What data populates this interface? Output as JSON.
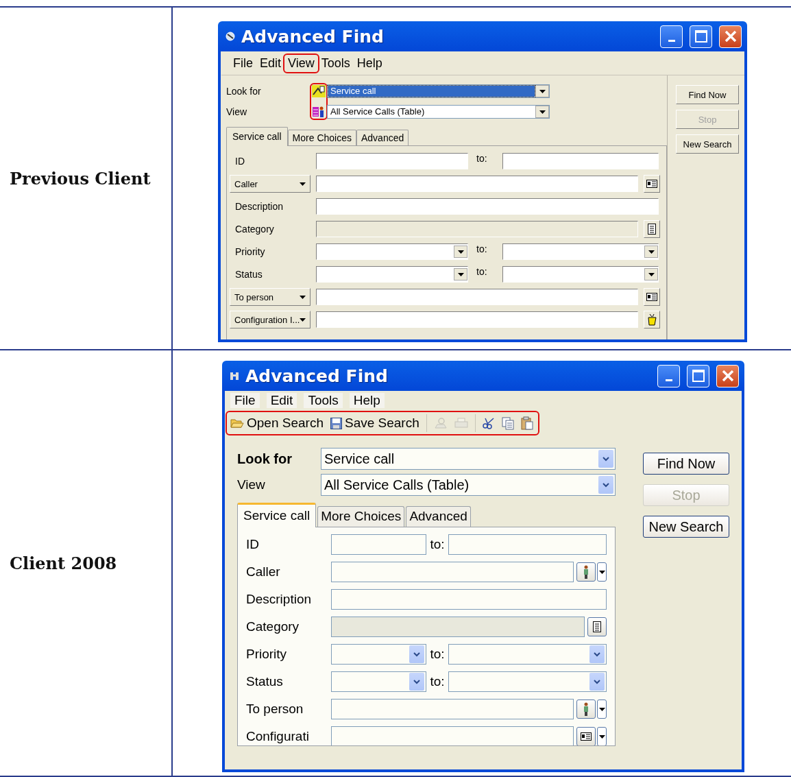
{
  "comparison": [
    {
      "label": "Previous Client",
      "window": {
        "kind": "classic",
        "title": "Advanced Find",
        "menu": [
          {
            "label": "File",
            "highlighted": false
          },
          {
            "label": "Edit",
            "highlighted": false
          },
          {
            "label": "View",
            "highlighted": true
          },
          {
            "label": "Tools",
            "highlighted": false
          },
          {
            "label": "Help",
            "highlighted": false
          }
        ],
        "type_icons_highlighted": true,
        "selectors": [
          {
            "label": "Look for",
            "value": "Service call",
            "selected": true
          },
          {
            "label": "View",
            "value": "All Service Calls (Table)",
            "selected": false
          }
        ],
        "tabs": [
          {
            "label": "Service call",
            "selected": true
          },
          {
            "label": "More Choices",
            "selected": false
          },
          {
            "label": "Advanced",
            "selected": false
          }
        ],
        "fields": [
          {
            "kind": "range",
            "label": "ID",
            "to": "to:",
            "label_dropdown": false
          },
          {
            "kind": "lookup",
            "label": "Caller",
            "label_dropdown": true
          },
          {
            "kind": "text",
            "label": "Description",
            "label_dropdown": false
          },
          {
            "kind": "category",
            "label": "Category",
            "label_dropdown": false
          },
          {
            "kind": "select_range",
            "label": "Priority",
            "to": "to:",
            "label_dropdown": false
          },
          {
            "kind": "select_range",
            "label": "Status",
            "to": "to:",
            "label_dropdown": false
          },
          {
            "kind": "lookup",
            "label": "To person",
            "label_dropdown": true
          },
          {
            "kind": "item",
            "label": "Configuration I...",
            "label_dropdown": true
          }
        ],
        "buttons": [
          {
            "label": "Find Now",
            "disabled": false
          },
          {
            "label": "Stop",
            "disabled": true
          },
          {
            "label": "New Search",
            "disabled": false
          }
        ]
      }
    },
    {
      "label": "Client 2008",
      "window": {
        "kind": "modern",
        "title": "Advanced Find",
        "menu": [
          {
            "label": "File",
            "highlighted": false
          },
          {
            "label": "Edit",
            "highlighted": false
          },
          {
            "label": "Tools",
            "highlighted": false
          },
          {
            "label": "Help",
            "highlighted": false
          }
        ],
        "toolbar_highlighted": true,
        "toolbar": [
          {
            "kind": "open",
            "label": "Open Search",
            "disabled": false
          },
          {
            "kind": "save",
            "label": "Save Search",
            "disabled": false
          },
          {
            "kind": "separator"
          },
          {
            "kind": "preview",
            "disabled": true
          },
          {
            "kind": "print",
            "disabled": true
          },
          {
            "kind": "separator"
          },
          {
            "kind": "cut",
            "disabled": false
          },
          {
            "kind": "copy",
            "disabled": false
          },
          {
            "kind": "paste",
            "disabled": false
          }
        ],
        "selectors": [
          {
            "label": "Look for",
            "value": "Service call",
            "bold": true
          },
          {
            "label": "View",
            "value": "All Service Calls (Table)",
            "bold": false
          }
        ],
        "tabs": [
          {
            "label": "Service call",
            "selected": true
          },
          {
            "label": "More Choices",
            "selected": false
          },
          {
            "label": "Advanced",
            "selected": false
          }
        ],
        "fields": [
          {
            "kind": "range",
            "label": "ID",
            "to": "to:"
          },
          {
            "kind": "lookup",
            "label": "Caller"
          },
          {
            "kind": "text",
            "label": "Description"
          },
          {
            "kind": "category",
            "label": "Category"
          },
          {
            "kind": "select_range",
            "label": "Priority",
            "to": "to:"
          },
          {
            "kind": "select_range",
            "label": "Status",
            "to": "to:"
          },
          {
            "kind": "lookup",
            "label": "To person"
          },
          {
            "kind": "item",
            "label": "Configurati"
          }
        ],
        "buttons": [
          {
            "label": "Find Now",
            "disabled": false
          },
          {
            "label": "Stop",
            "disabled": true
          },
          {
            "label": "New Search",
            "disabled": false
          }
        ]
      }
    }
  ]
}
